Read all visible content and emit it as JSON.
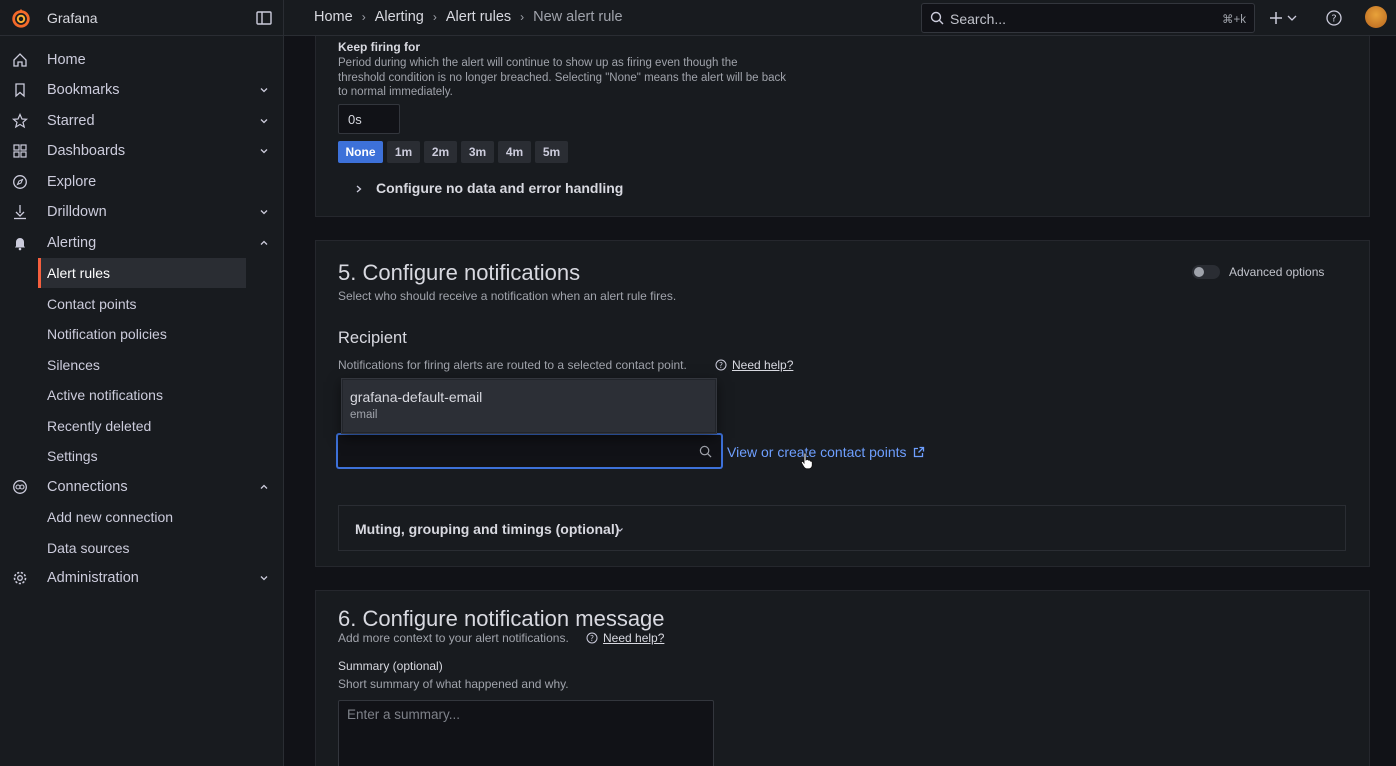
{
  "app": {
    "name": "Grafana"
  },
  "breadcrumbs": [
    "Home",
    "Alerting",
    "Alert rules",
    "New alert rule"
  ],
  "search": {
    "placeholder": "Search...",
    "shortcut": "⌘+k"
  },
  "nav": {
    "items": [
      {
        "label": "Home",
        "icon": "home-icon"
      },
      {
        "label": "Bookmarks",
        "icon": "bookmark-icon",
        "chevron": "down"
      },
      {
        "label": "Starred",
        "icon": "star-icon",
        "chevron": "down"
      },
      {
        "label": "Dashboards",
        "icon": "apps-icon",
        "chevron": "down"
      },
      {
        "label": "Explore",
        "icon": "compass-icon"
      },
      {
        "label": "Drilldown",
        "icon": "drilldown-icon",
        "chevron": "down"
      },
      {
        "label": "Alerting",
        "icon": "bell-icon",
        "chevron": "up"
      },
      {
        "label": "Connections",
        "icon": "connections-icon",
        "chevron": "up"
      },
      {
        "label": "Administration",
        "icon": "cog-icon",
        "chevron": "down"
      }
    ],
    "alerting_sub": [
      "Alert rules",
      "Contact points",
      "Notification policies",
      "Silences",
      "Active notifications",
      "Recently deleted",
      "Settings"
    ],
    "connections_sub": [
      "Add new connection",
      "Data sources"
    ]
  },
  "keep_firing": {
    "label": "Keep firing for",
    "description": "Period during which the alert will continue to show up as firing even though the threshold condition is no longer breached. Selecting \"None\" means the alert will be back to normal immediately.",
    "value": "0s",
    "options": [
      "None",
      "1m",
      "2m",
      "3m",
      "4m",
      "5m"
    ],
    "selected": "None",
    "no_data_toggle": "Configure no data and error handling"
  },
  "notifications": {
    "title": "5. Configure notifications",
    "subtitle": "Select who should receive a notification when an alert rule fires.",
    "advanced": "Advanced options",
    "recipient": {
      "title": "Recipient",
      "description": "Notifications for firing alerts are routed to a selected contact point.",
      "help": "Need help?",
      "option_name": "grafana-default-email",
      "option_type": "email",
      "view_link": "View or create contact points"
    },
    "muting": "Muting, grouping and timings (optional)"
  },
  "message": {
    "title": "6. Configure notification message",
    "subtitle": "Add more context to your alert notifications.",
    "help": "Need help?",
    "summary_label": "Summary (optional)",
    "summary_desc": "Short summary of what happened and why.",
    "summary_placeholder": "Enter a summary..."
  },
  "colors": {
    "accent": "#3d71d9",
    "brand": "#f55f3e"
  }
}
